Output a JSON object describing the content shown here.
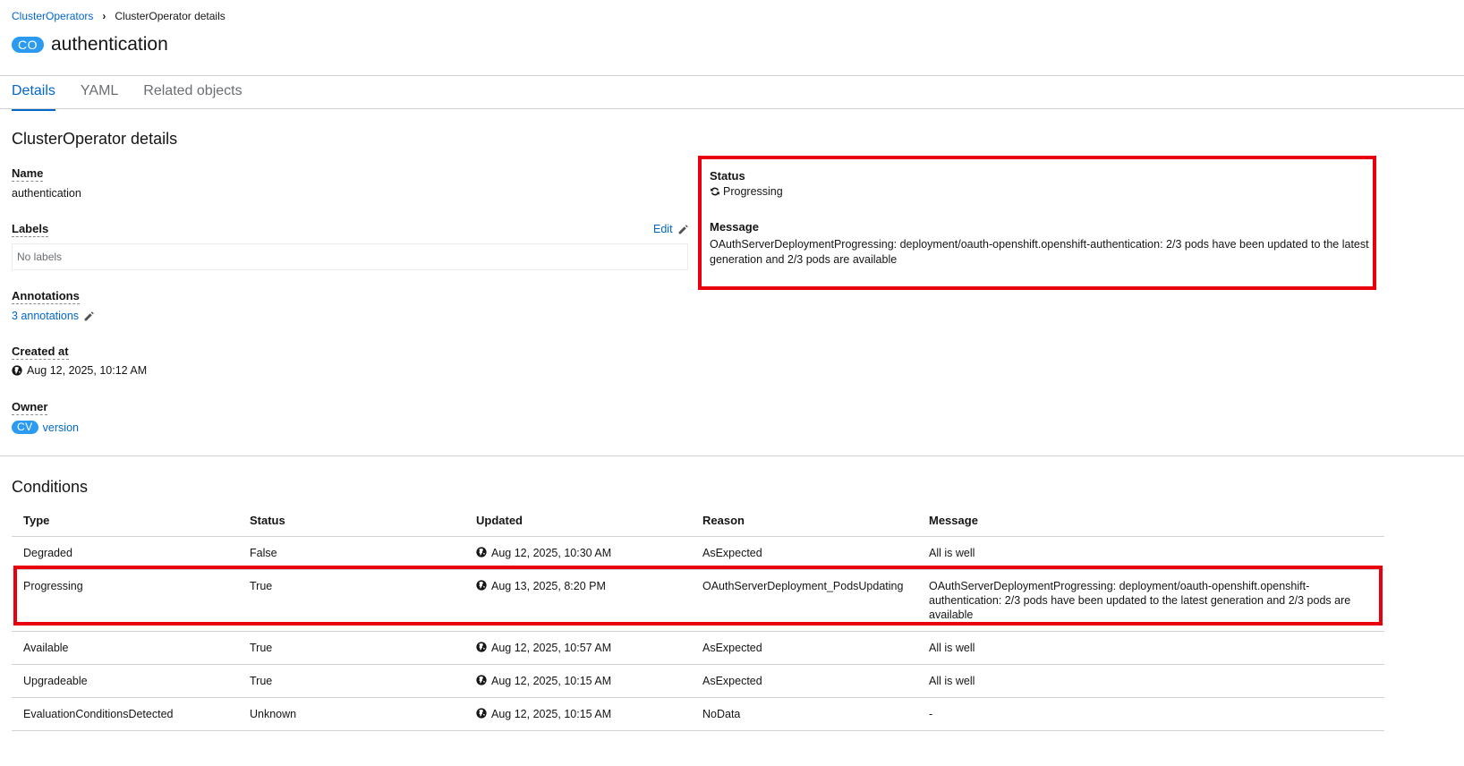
{
  "breadcrumb": {
    "parent": "ClusterOperators",
    "current": "ClusterOperator details"
  },
  "header": {
    "badge": "CO",
    "title": "authentication"
  },
  "tabs": [
    {
      "label": "Details"
    },
    {
      "label": "YAML"
    },
    {
      "label": "Related objects"
    }
  ],
  "details": {
    "section_title": "ClusterOperator details",
    "name_label": "Name",
    "name_value": "authentication",
    "labels_label": "Labels",
    "labels_edit": "Edit",
    "labels_empty": "No labels",
    "annotations_label": "Annotations",
    "annotations_link": "3 annotations",
    "created_label": "Created at",
    "created_value": "Aug 12, 2025, 10:12 AM",
    "owner_label": "Owner",
    "owner_badge": "CV",
    "owner_link": "version",
    "status_label": "Status",
    "status_value": "Progressing",
    "message_label": "Message",
    "message_value": "OAuthServerDeploymentProgressing: deployment/oauth-openshift.openshift-authentication: 2/3 pods have been updated to the latest generation and 2/3 pods are available"
  },
  "conditions": {
    "title": "Conditions",
    "headers": {
      "type": "Type",
      "status": "Status",
      "updated": "Updated",
      "reason": "Reason",
      "message": "Message"
    },
    "rows": [
      {
        "type": "Degraded",
        "status": "False",
        "updated": "Aug 12, 2025, 10:30 AM",
        "reason": "AsExpected",
        "message": "All is well"
      },
      {
        "type": "Progressing",
        "status": "True",
        "updated": "Aug 13, 2025, 8:20 PM",
        "reason": "OAuthServerDeployment_PodsUpdating",
        "message": "OAuthServerDeploymentProgressing: deployment/oauth-openshift.openshift-authentication: 2/3 pods have been updated to the latest generation and 2/3 pods are available"
      },
      {
        "type": "Available",
        "status": "True",
        "updated": "Aug 12, 2025, 10:57 AM",
        "reason": "AsExpected",
        "message": "All is well"
      },
      {
        "type": "Upgradeable",
        "status": "True",
        "updated": "Aug 12, 2025, 10:15 AM",
        "reason": "AsExpected",
        "message": "All is well"
      },
      {
        "type": "EvaluationConditionsDetected",
        "status": "Unknown",
        "updated": "Aug 12, 2025, 10:15 AM",
        "reason": "NoData",
        "message": "-"
      }
    ]
  },
  "colors": {
    "link": "#0066cc",
    "badge": "#2b9af3",
    "highlight": "#e8000e",
    "divider": "#d2d2d2"
  }
}
